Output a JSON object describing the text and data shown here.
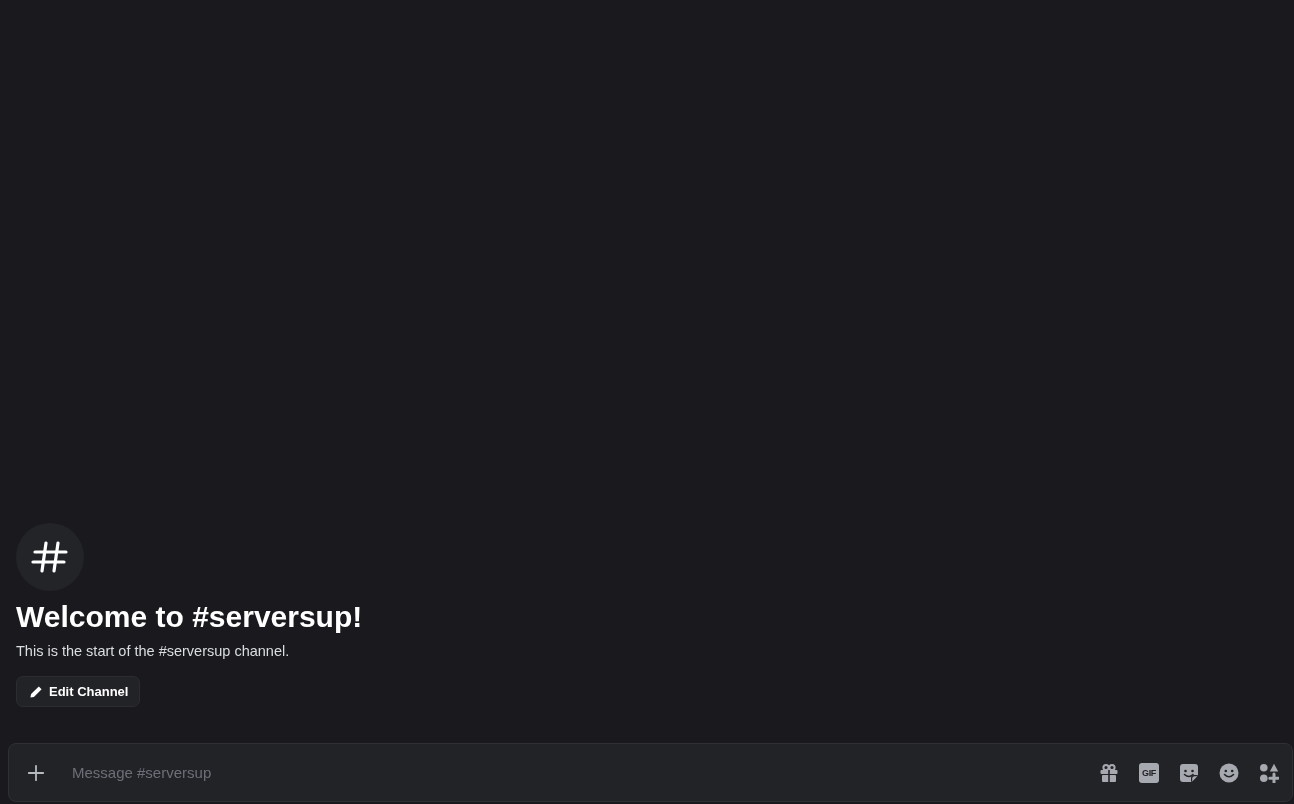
{
  "welcome": {
    "title": "Welcome to #serversup!",
    "subtitle": "This is the start of the #serversup channel.",
    "button": "Edit Channel"
  },
  "composer": {
    "placeholder": "Message #serversup",
    "gif_label": "GIF"
  }
}
